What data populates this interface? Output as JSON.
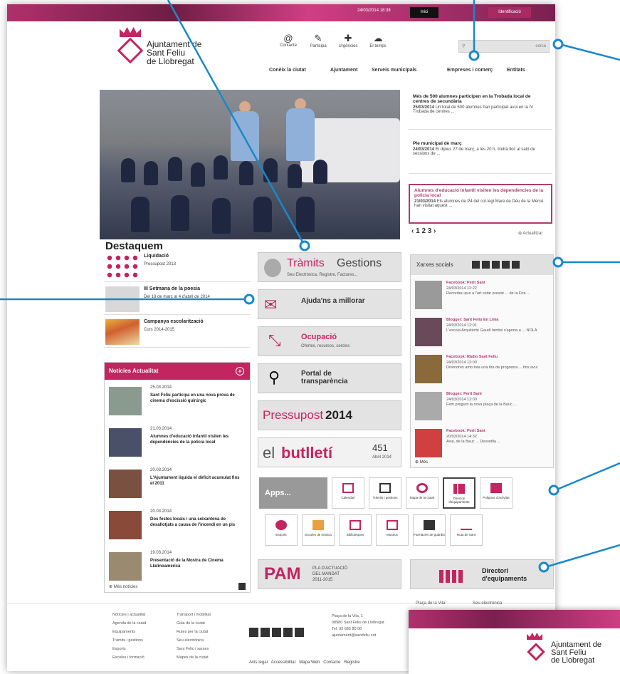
{
  "topbar": {
    "date": "24/03/2014 18:38",
    "login": "Inici",
    "register": "Identificació"
  },
  "site": {
    "name_line1": "Ajuntament de",
    "name_line2": "Sant Feliu",
    "name_line3": "de Llobregat"
  },
  "nav_icons": [
    {
      "label": "Contacte",
      "glyph": "@"
    },
    {
      "label": "Participa",
      "glyph": "✎"
    },
    {
      "label": "Urgències",
      "glyph": "✚"
    },
    {
      "label": "El temps",
      "glyph": "☁"
    }
  ],
  "main_nav": [
    "Conèix la ciutat",
    "Ajuntament",
    "Serveis municipals",
    "Empreses i comerç",
    "Entitats"
  ],
  "search": {
    "placeholder": "",
    "button": "cerca"
  },
  "news": [
    {
      "title": "Més de 500 alumnes participen en la Trobada local de centres de secundària",
      "date": "25/03/2014",
      "text": "Un total de 500 alumnes han participat avui en la IV Trobada de centres ..."
    },
    {
      "title": "Ple municipal de març",
      "date": "24/03/2014",
      "text": "El dijous 27 de març, a les 20 h, tindrà lloc al saló de sessions de ..."
    },
    {
      "title": "Alumnes d'educació infantil visiten les dependències de la policia local",
      "date": "21/03/2014",
      "text": "Els alumnes de P4 del col·legi Mare de Déu de la Mercè han visitat aquest ..."
    }
  ],
  "pager": "‹ 1 2 3 ›",
  "actualitzar": "Actualitzar",
  "destaquem": {
    "title": "Destaquem",
    "items": [
      {
        "title": "Liquidació",
        "sub": "Pressupost 2013"
      },
      {
        "title": "III Setmana de la poesia",
        "sub": "Del 18 de març al 4 d'abril de 2014"
      },
      {
        "title": "Campanya escolarització",
        "sub": "Curs 2014-2015"
      }
    ]
  },
  "noticies": {
    "title": "Notícies Actualitat",
    "footer": "Més notícies",
    "items": [
      {
        "date": "25.03.2014",
        "title": "Sant Feliu participa en una nova prova de cinema d'escissió quirúrgic"
      },
      {
        "date": "21.03.2014",
        "title": "Alumnes d'educació infantil visiten les dependències de la policia local"
      },
      {
        "date": "20.03.2014",
        "title": "L'Ajuntament liquida el dèficit acumulat fins el 2011"
      },
      {
        "date": "20.03.2014",
        "title": "Dos festes locals i una seixantena de desallotjats a causa de l'incendi en un pis"
      },
      {
        "date": "19.03.2014",
        "title": "Presentació de la Mostra de Cinema Llatinoamericà"
      }
    ]
  },
  "mid": {
    "tramits_a": "Tràmits",
    "tramits_b": "Gestions",
    "tramits_sub": "Seu Electrònica, Registre, Factures...",
    "ajuda": "Ajuda'ns a millorar",
    "ocupacio": "Ocupació",
    "ocupacio_sub": "Ofertes, recursos, cercles",
    "portal": "Portal de transparència",
    "pressu": "Pressupost",
    "pressu_year": "2014",
    "butlleti_a": "el",
    "butlleti_b": "butlletí",
    "butlleti_num": "451",
    "butlleti_date": "Abril 2014"
  },
  "social": {
    "title": "Xarxes socials",
    "footer": "Més",
    "items": [
      {
        "title": "Facebook: Perit Sant",
        "date": "24/03/2014 12:22",
        "text": "Recordeu que a l'art estar previst ... de la Fira ..."
      },
      {
        "title": "Blogger: Sant Feliu En Línia",
        "date": "24/03/2014 12:01",
        "text": "L'escola Arquitecte Gaudí també s'aporta a ... NOLA"
      },
      {
        "title": "Facebook: Ràdio Sant Feliu",
        "date": "24/03/2014 12:00",
        "text": "Divendres amb tota una fira de programa ... fins avui"
      },
      {
        "title": "Blogger: Perit Sant",
        "date": "24/03/2014 12:00",
        "text": "Fem pregunt la nova plaça de la Bauc ..."
      },
      {
        "title": "Facebook: Perit Sant",
        "date": "20/03/2014 14:32",
        "text": "Avui, de la Bauc ... Desvetlla ..."
      }
    ]
  },
  "apps": {
    "label": "Apps...",
    "row1": [
      "Calendari",
      "Tràmits i gestions",
      "Mapa de la ciutat",
      "Directori d'equipaments",
      "Polígons d'activitat"
    ],
    "row2": [
      "Esports",
      "Escoles de música",
      "Biblioteques",
      "Museus",
      "Farmàcies de guàrdia",
      "Ruta de Sant"
    ]
  },
  "pam": {
    "title": "PAM",
    "line1": "PLA D'ACTUACIÓ",
    "line2": "DEL MANDAT",
    "line3": "2011-2015"
  },
  "directori": {
    "line1": "Directori",
    "line2": "d'equipaments"
  },
  "footer": {
    "col1": [
      "Notícies i actualitat",
      "Agenda de la ciutat",
      "Equipaments",
      "Tràmits i gestions",
      "Esports",
      "Escoles i formació"
    ],
    "col2": [
      "Transport i mobilitat",
      "Guia de la ciutat",
      "Rutes per la ciutat",
      "Seu electrònica",
      "Sant Feliu i xarxes",
      "Mapes de la ciutat"
    ],
    "address": [
      "Plaça de la Vila, 1",
      "08980 Sant Feliu de Llobregat",
      "Tel. 93 685 80 00",
      "ajuntament@santfeliu.cat"
    ],
    "bottom": [
      "Avís legal",
      "Accessibilitat",
      "Mapa Web",
      "Contacte",
      "Registre"
    ],
    "inset_small": [
      "Plaça de la Vila",
      "Seu electrònica"
    ]
  },
  "colors": {
    "brand": "#c2255f",
    "callout": "#1a88c9"
  }
}
